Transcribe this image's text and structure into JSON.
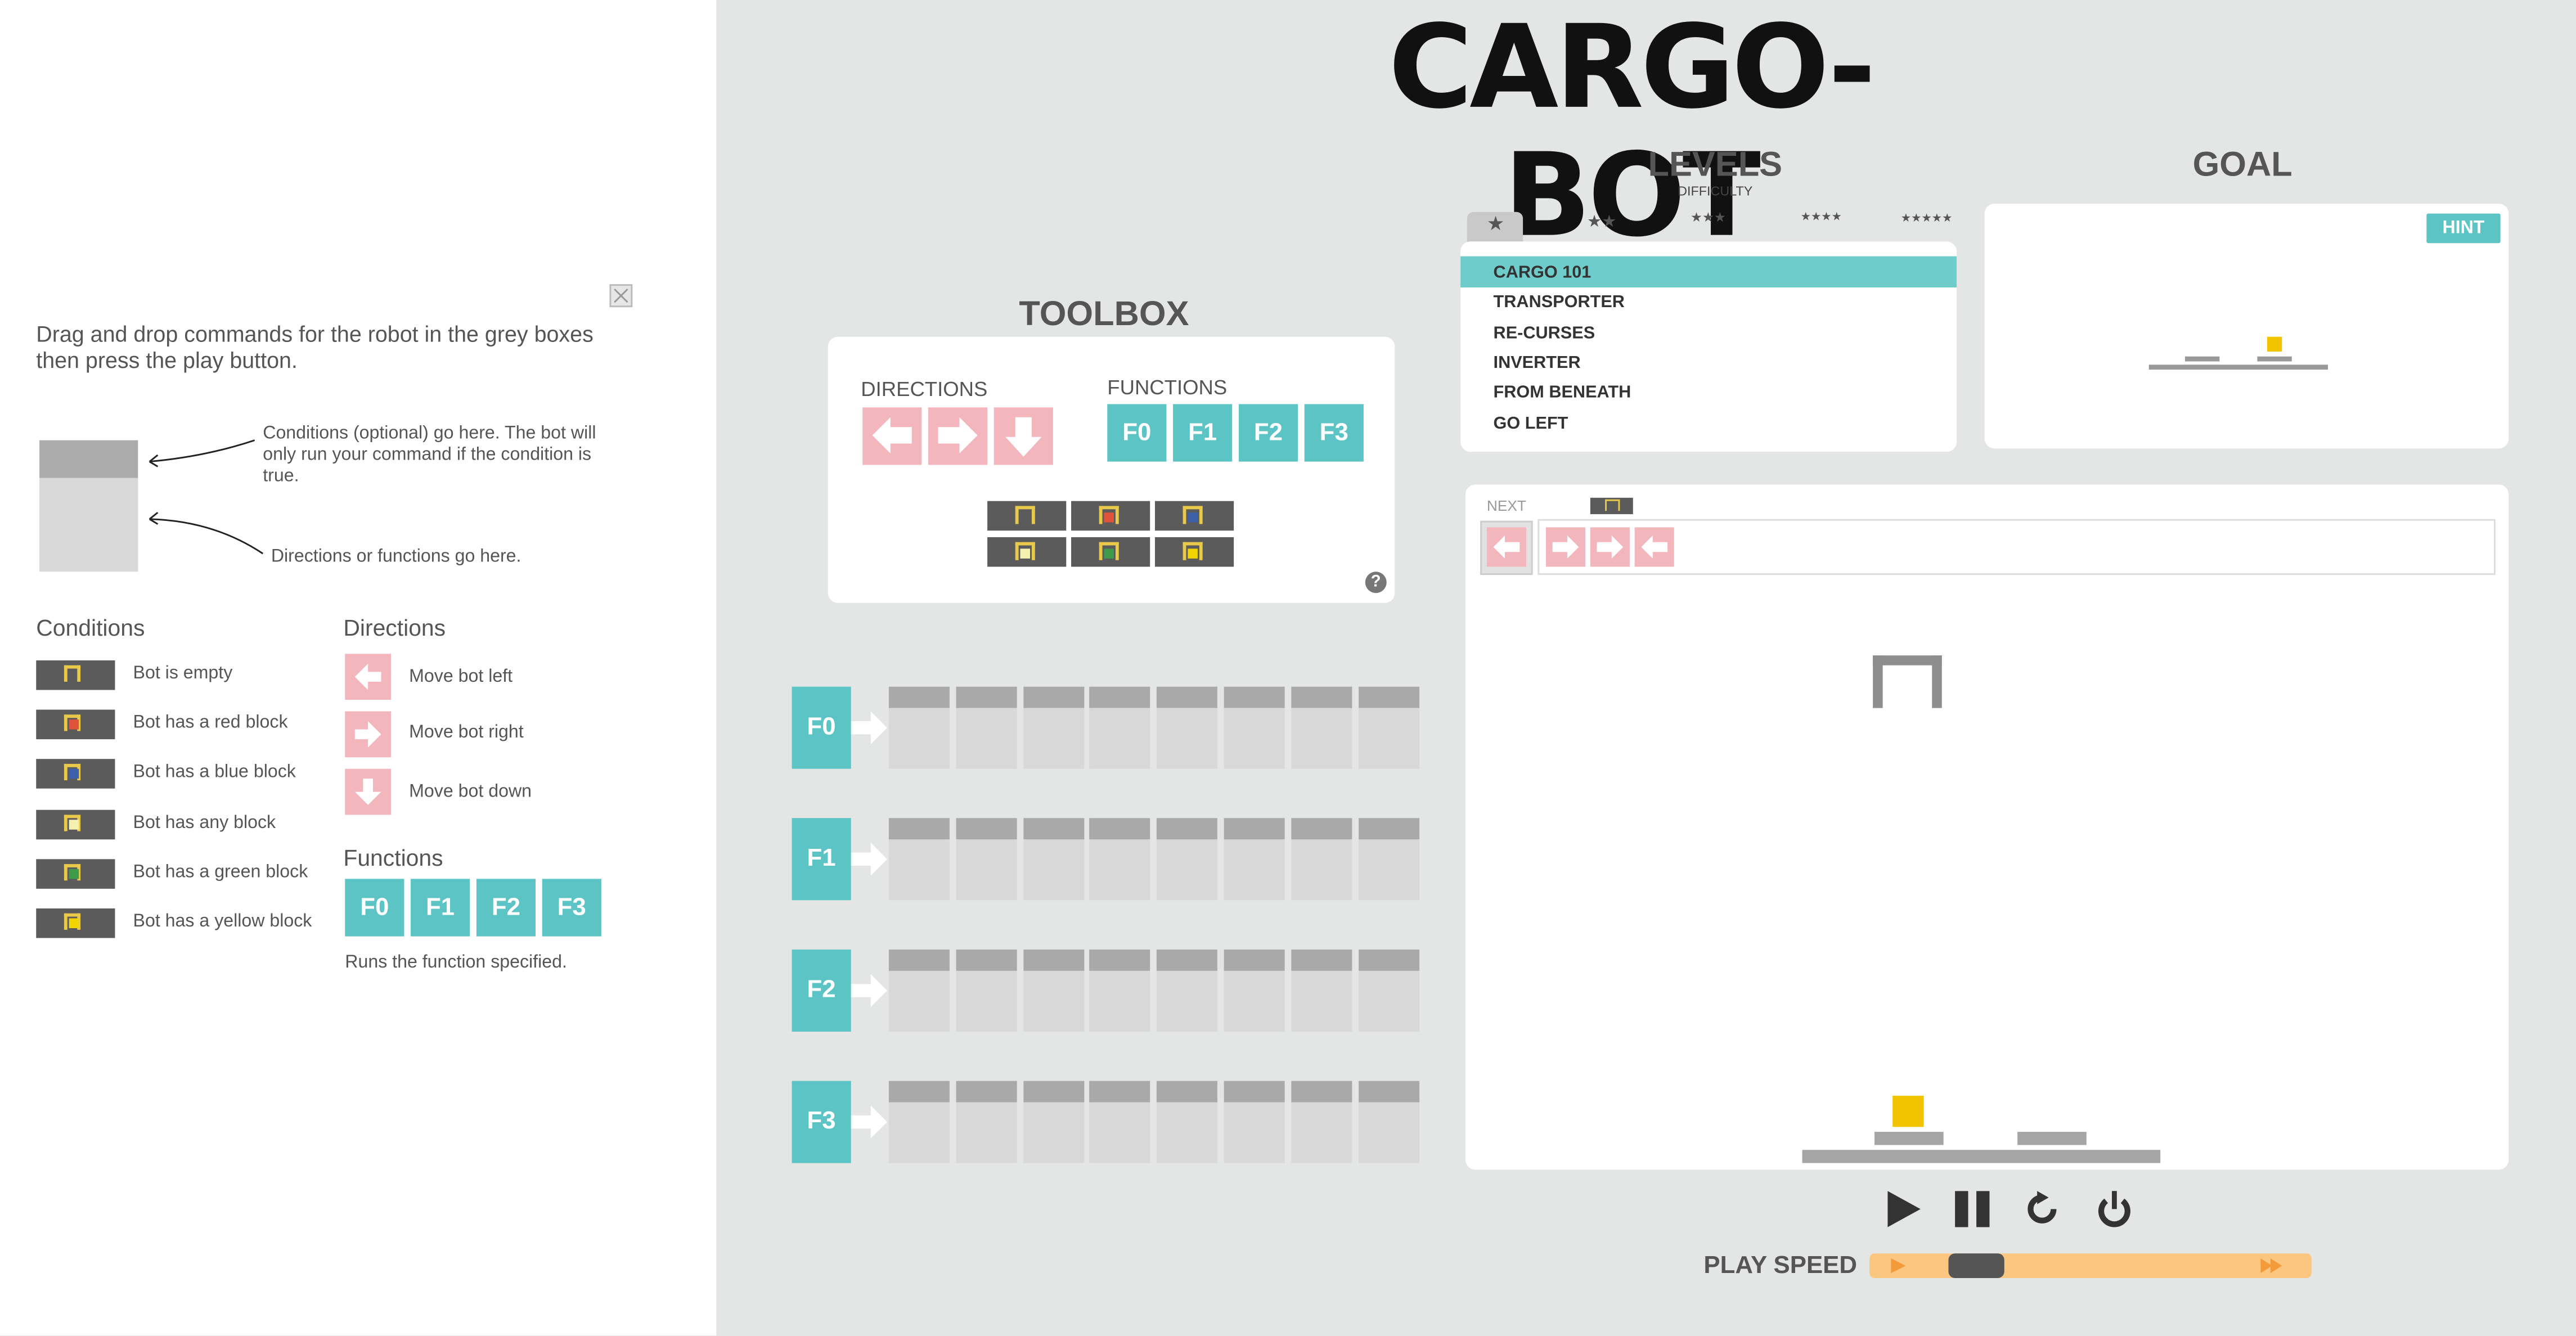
{
  "app": {
    "title": "CARGO-BOT"
  },
  "help": {
    "intro": "Drag and drop commands for the robot in the grey boxes then press the play button.",
    "note_condition": "Conditions (optional) go here. The bot will only run your command if the condition is true.",
    "note_direction": "Directions or functions go here.",
    "conditions_title": "Conditions",
    "conditions": [
      {
        "label": "Bot is empty",
        "color": ""
      },
      {
        "label": "Bot has a red block",
        "color": "#e0533a"
      },
      {
        "label": "Bot has a blue block",
        "color": "#3d5ea8"
      },
      {
        "label": "Bot has any block",
        "color": "#f5f0b0"
      },
      {
        "label": "Bot has a green block",
        "color": "#3f9a4a"
      },
      {
        "label": "Bot has a yellow block",
        "color": "#f2d400"
      }
    ],
    "directions_title": "Directions",
    "directions": [
      "Move bot left",
      "Move bot right",
      "Move bot down"
    ],
    "functions_title": "Functions",
    "functions": [
      "F0",
      "F1",
      "F2",
      "F3"
    ],
    "functions_note": "Runs the function specified."
  },
  "toolbox": {
    "title": "TOOLBOX",
    "directions_label": "DIRECTIONS",
    "functions_label": "FUNCTIONS",
    "functions": [
      "F0",
      "F1",
      "F2",
      "F3"
    ],
    "help_icon": "?"
  },
  "program": {
    "rows": [
      "F0",
      "F1",
      "F2",
      "F3"
    ],
    "slots_per_row": 8
  },
  "levels": {
    "title": "LEVELS",
    "subtitle": "DIFFICULTY",
    "tabs": [
      "★",
      "★★",
      "★★★",
      "★★★★",
      "★★★★★"
    ],
    "items": [
      "CARGO 101",
      "TRANSPORTER",
      "RE-CURSES",
      "INVERTER",
      "FROM BENEATH",
      "GO LEFT"
    ],
    "selected": 0
  },
  "goal": {
    "title": "GOAL",
    "hint_label": "HINT"
  },
  "stage": {
    "next_label": "NEXT"
  },
  "controls": {
    "play_speed_label": "PLAY SPEED",
    "speed_fraction": 0.1
  },
  "colors": {
    "teal": "#5cc4c4",
    "pink": "#f4b6bd",
    "yellow": "#f2c400",
    "orange": "#fbc67f"
  }
}
